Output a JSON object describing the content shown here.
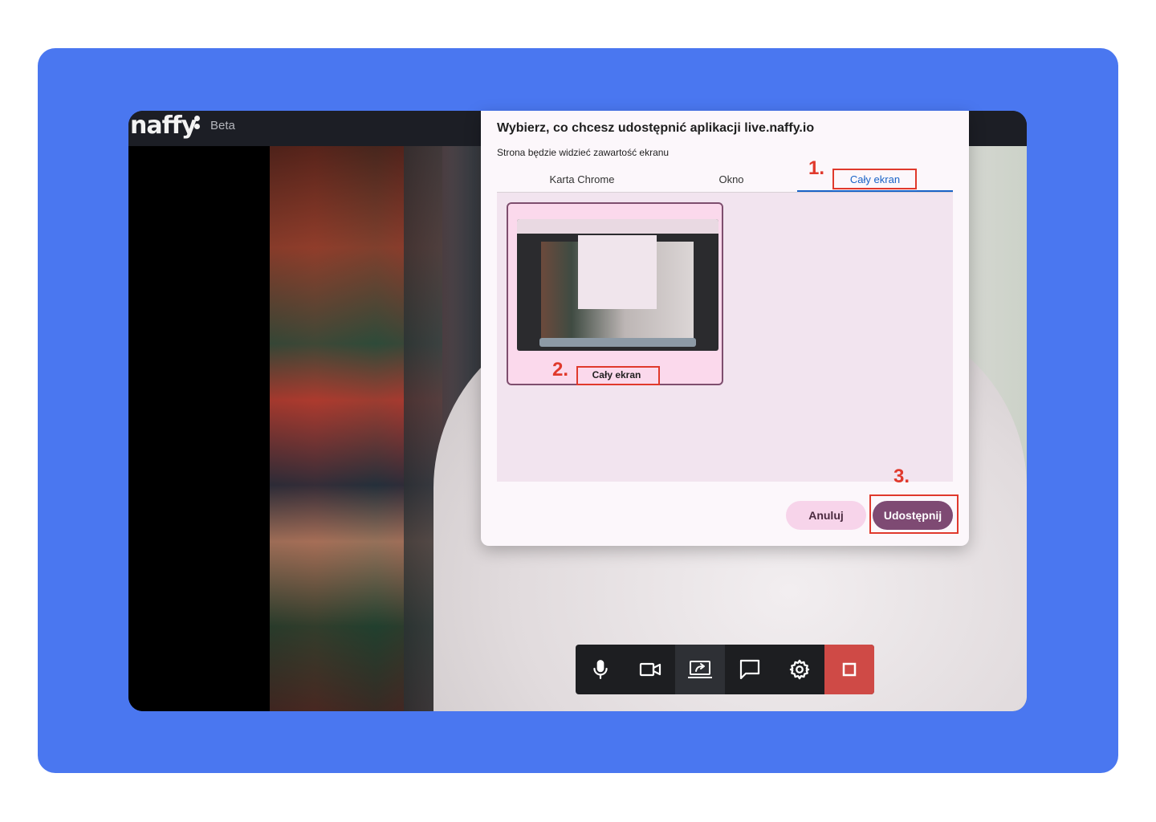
{
  "app": {
    "logo_text": "naffy",
    "beta_label": "Beta"
  },
  "dialog": {
    "title": "Wybierz, co chcesz udostępnić aplikacji live.naffy.io",
    "subtitle": "Strona będzie widzieć zawartość ekranu",
    "tabs": [
      {
        "label": "Karta Chrome",
        "selected": false
      },
      {
        "label": "Okno",
        "selected": false
      },
      {
        "label": "Cały ekran",
        "selected": true
      }
    ],
    "thumbnail_label": "Cały ekran",
    "cancel_label": "Anuluj",
    "share_label": "Udostępnij"
  },
  "annotations": {
    "step1": "1.",
    "step2": "2.",
    "step3": "3.",
    "color": "#e0392c"
  },
  "toolbar": {
    "buttons": [
      {
        "name": "microphone-icon"
      },
      {
        "name": "camera-icon"
      },
      {
        "name": "screen-share-icon",
        "active": true
      },
      {
        "name": "chat-icon"
      },
      {
        "name": "settings-icon"
      },
      {
        "name": "end-call-icon"
      }
    ]
  },
  "colors": {
    "background_panel": "#4a77f0",
    "share_button": "#7e4a73",
    "cancel_button": "#f7d4ea",
    "tab_accent": "#1a63c7",
    "end_button": "#cf4a46"
  }
}
